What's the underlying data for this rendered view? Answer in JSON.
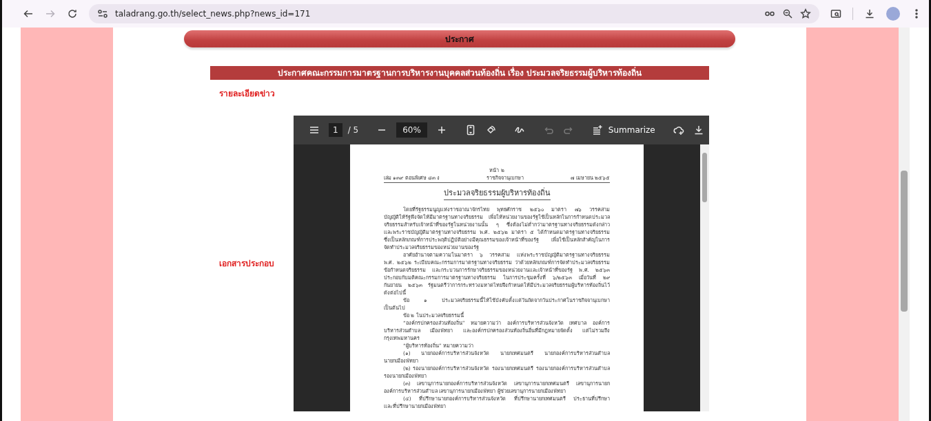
{
  "browser": {
    "nav_buttons": [
      {
        "kind": "back",
        "disabled": false
      },
      {
        "kind": "forward",
        "disabled": true
      },
      {
        "kind": "reload",
        "disabled": false
      }
    ],
    "url": "taladrang.go.th/select_news.php?news_id=171"
  },
  "page": {
    "header": "ประกาศ",
    "title": "ประกาศคณะกรรมการมาตรฐานการบริหารงานบุคคลส่วนท้องถิ่น เรื่อง ประมวลจริยธรรมผู้บริหารท้องถิ่น",
    "details_label": "รายละเอียดข่าว",
    "attachment_label": "เอกสารประกอบ"
  },
  "pdf_viewer": {
    "page_input": "1",
    "page_count": "/ 5",
    "zoom": "60%",
    "tools": [
      {
        "kind": "undo",
        "disabled": true
      },
      {
        "kind": "redo",
        "disabled": true
      }
    ],
    "summarize_label": "Summarize",
    "document": {
      "page_number": "หน้า ๒",
      "volume": "เล่ม ๑๓๙ ตอนพิเศษ ๘๓ ง",
      "gazette": "ราชกิจจานุเบกษา",
      "date": "๗ เมษายน ๒๕๖๕",
      "title": "ประมวลจริยธรรมผู้บริหารท้องถิ่น",
      "paragraphs": [
        {
          "lines": [
            "โดยที่รัฐธรรมนูญแห่งราชอาณาจักรไทย พุทธศักราช ๒๕๖๐ มาตรา ๗๖ วรรคสาม",
            "บัญญัติให้รัฐพึงจัดให้มีมาตรฐานทางจริยธรรม เพื่อให้หน่วยงานของรัฐใช้เป็นหลักในการกำหนดประมวล",
            "จริยธรรมสำหรับเจ้าหน้าที่ของรัฐในหน่วยงานนั้น ๆ ซึ่งต้องไม่ต่ำกว่ามาตรฐานทางจริยธรรมดังกล่าว",
            "และพระราชบัญญัติมาตรฐานทางจริยธรรม พ.ศ. ๒๕๖๒ มาตรา ๕ ได้กำหนดมาตรฐานทางจริยธรรม",
            "ซึ่งเป็นหลักเกณฑ์การประพฤติปฏิบัติอย่างมีคุณธรรมของเจ้าหน้าที่ของรัฐ เพื่อใช้เป็นหลักสำคัญในการ",
            "จัดทำประมวลจริยธรรมของหน่วยงานของรัฐ"
          ]
        },
        {
          "lines": [
            "อาศัยอำนาจตามความในมาตรา ๖ วรรคสาม แห่งพระราชบัญญัติมาตรฐานทางจริยธรรม",
            "พ.ศ. ๒๕๖๒ ระเบียบคณะกรรมการมาตรฐานทางจริยธรรม ว่าด้วยหลักเกณฑ์การจัดทำประมวลจริยธรรม",
            "ข้อกำหนดจริยธรรม และกระบวนการรักษาจริยธรรมของหน่วยงานและเจ้าหน้าที่ของรัฐ พ.ศ. ๒๕๖๓",
            "ประกอบกับมติคณะกรรมการมาตรฐานทางจริยธรรม ในการประชุมครั้งที่ ๖/๒๕๖๓ เมื่อวันที่ ๒๙",
            "กันยายน ๒๕๖๓ รัฐมนตรีว่าการกระทรวงมหาดไทยจึงกำหนดให้มีประมวลจริยธรรมผู้บริหารท้องถิ่นไว้",
            "ดังต่อไปนี้"
          ]
        },
        {
          "lines": [
            "ข้อ ๑ ประมวลจริยธรรมนี้ให้ใช้บังคับตั้งแต่วันถัดจากวันประกาศในราชกิจจานุเบกษา",
            "เป็นต้นไป"
          ]
        },
        {
          "lines": [
            "ข้อ ๒ ในประมวลจริยธรรมนี้"
          ]
        },
        {
          "lines": [
            "“องค์กรปกครองส่วนท้องถิ่น” หมายความว่า องค์การบริหารส่วนจังหวัด เทศบาล องค์การ",
            "บริหารส่วนตำบล เมืองพัทยา และองค์กรปกครองส่วนท้องถิ่นอื่นที่มีกฎหมายจัดตั้ง แต่ไม่รวมถึง",
            "กรุงเทพมหานคร"
          ]
        },
        {
          "lines": [
            "“ผู้บริหารท้องถิ่น” หมายความว่า"
          ]
        },
        {
          "lines": [
            "(๑) นายกองค์การบริหารส่วนจังหวัด นายกเทศมนตรี นายกองค์การบริหารส่วนตำบล",
            "นายกเมืองพัทยา"
          ]
        },
        {
          "lines": [
            "(๒) รองนายกองค์การบริหารส่วนจังหวัด รองนายกเทศมนตรี รองนายกองค์การบริหารส่วนตำบล",
            "รองนายกเมืองพัทยา"
          ]
        },
        {
          "lines": [
            "(๓) เลขานุการนายกองค์การบริหารส่วนจังหวัด เลขานุการนายกเทศมนตรี เลขานุการนายก",
            "องค์การบริหารส่วนตำบล เลขานุการนายกเมืองพัทยา ผู้ช่วยเลขานุการนายกเมืองพัทยา"
          ]
        },
        {
          "lines": [
            "(๔) ที่ปรึกษานายกองค์การบริหารส่วนจังหวัด ที่ปรึกษานายกเทศมนตรี ประธานที่ปรึกษา",
            "และที่ปรึกษานายกเมืองพัทยา"
          ]
        }
      ]
    }
  }
}
